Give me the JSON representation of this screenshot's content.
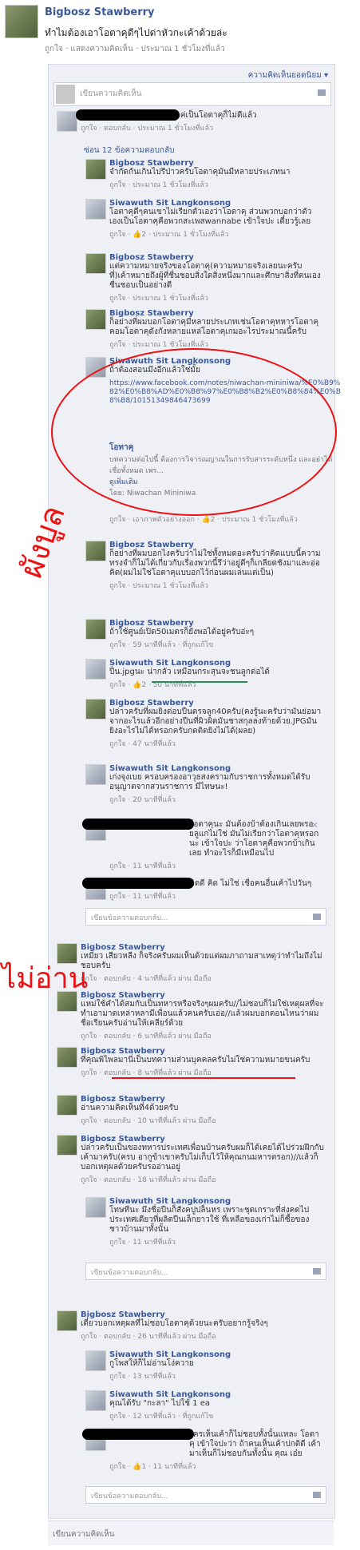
{
  "post": {
    "author": "Bigbosz Stawberry",
    "text": "ทำไมต้องเอาโอตาคุดีๆไปด่าหัวกะเค้าด้วยล่ะ",
    "meta": "ถูกใจ · แสดงความคิดเห็น · ประมาณ 1 ชั่วโมงที่แล้ว"
  },
  "top_link": "ความคิดเห็นยอดนิยม ▾",
  "compose_placeholder": "เขียนความคิดเห็น",
  "reply_placeholder": "เขียนข้อความตอบกลับ...",
  "bottom_placeholder": "เขียนความคิดเห็น",
  "c0": {
    "body": "เเค่เป็นโอตาคุก็ไม่ดีแล้ว",
    "meta": "ถูกใจ · ตอบกลับ · ประมาณ 1 ชั่วโมงที่แล้ว"
  },
  "hide_replies": "ซ่อน 12 ข้อความตอบกลับ",
  "replies": [
    {
      "name": "Bigbosz Stawberry",
      "body": "จำกัดกันเกินไปรึป่าวครับโอตาคุมันมีหลายประเภทนา",
      "meta": "ถูกใจ · ประมาณ 1 ชั่วโมงที่แล้ว"
    },
    {
      "name": "Siwawuth Sit Langkonsong",
      "body": "โอตาคุดีๆคนเขาไม่เรียกตัวเองว่าโอตาคุ ส่วนพวกบอกว่าตัวเองเป็นโอตาคุคือพวกสะเพสwannabe เข้าใจปะ เดี๋ยวรู้เลย",
      "meta": "ถูกใจ · 👍2 · ประมาณ 1 ชั่วโมงที่แล้ว"
    },
    {
      "name": "Bigbosz Stawberry",
      "body": "แต่ความหมายจริงของโอตาคุ(ความหมายจริงเลยนะครับที่)เค้าหมายถึงผู้ที่ชื่นชอบสิ่งใดสิ่งหนึ่งมากและศึกษาสิ่งที่ตนเองชื่นชอบเป็นอย่างดี",
      "meta": "ถูกใจ · ประมาณ 1 ชั่วโมงที่แล้ว"
    },
    {
      "name": "Bigbosz Stawberry",
      "body": "ก็อย่างที่ผมบอกโอตาคุมีหลายประเภทเช่นโอตาคุทหารโอตาคุคอมโอตาคุดังกังหลายแหล่โอตาคุเกมอะไรประมาณนี้ครับ",
      "meta": "ถูกใจ · ประมาณ 1 ชั่วโมงที่แล้ว"
    },
    {
      "name": "Siwawuth Sit Langkonsong",
      "body": "ถ้าต้องสอนมึงอีกแล้วใช่มั้ย",
      "link": "https://www.facebook.com/notes/niwachan-mininiwa/%E0%B9%82%E0%B8%AD%E0%B8%97%E0%B8%B2%E0%B8%84%E0%B8%B8/10151349846473699",
      "preview_title": "โอทาคุ",
      "preview_desc": "บทความต่อไปนี้ ต้องการวิจารณญาณในการรับสารระดับหนึ่ง และอย่าได้เชื่อทั้งหมด เพร...",
      "preview_src": "ดูเพิ่มเติม",
      "preview_by": "โดย: Niwachan Mininiwa",
      "meta": "ถูกใจ · เอาภาพตัวอย่างออก · 👍2 · ประมาณ 1 ชั่วโมงที่แล้ว"
    },
    {
      "name": "Bigbosz Stawberry",
      "body": "ก็อย่างที่ผมบอกไงครับว่าไม่ใช่ทั้งหมดอะครับว่าคิดแบบนี้ความทรงจำก็ไม่ได้เกี่ยวกับเรื่องพวกนี้รึว่าอยู่ดีๆก็เกลียดชังมาและอ่อคิด(ผมไม่ใช่โอตาคุแบบอกไว้ก่อนผมเล่นแต่เป็น)",
      "meta": "ถูกใจ · ประมาณ 1 ชั่วโมงที่แล้ว"
    },
    {
      "name": "Bigbosz Stawberry",
      "body": "ถ้าใช้ศูนย์เปิด50เมตรก็ยังพอได้อยู่ครับอ่ะๆ",
      "meta": "ถูกใจ · 59 นาทีที่แล้ว · ที่ถูกแก้ไข"
    },
    {
      "name": "Siwawuth Sit Langkonsong",
      "body": "ปื่น.jpgนะ น่ากลัว เหมือนกระสุนจะชนลูกต่อได้",
      "meta": "ถูกใจ · 👍2 · 50 นาทีที่แล้ว"
    },
    {
      "name": "Bigbosz Stawberry",
      "body": "ปล่าวครับที่ผมยิงต่อบปืนตรจลูก40ครับ(คงรู้นะครับว่ามันย่อมาจากอะไรแล้วอีกอย่างปืนที่ผิวผิดมันชาสกุลลงท้ายด้วย.JPGมันยิงอะไรไม่ได้หรอกครับกดติดยิงไม่ได้(ผลย)",
      "meta": "ถูกใจ · 47 นาทีที่แล้ว"
    },
    {
      "name": "Siwawuth Sit Langkonsong",
      "body": "เก่งจุงเบย ครอบครองอาวุธสงครามกับราชการทั้งหมดได้รับอนุญาตจากสวนราชการ มีไทษนะ!",
      "meta": "ถูกใจ · 20 นาทีที่แล้ว"
    },
    {
      "name": "",
      "body": "โอตาคุนะ มันต้องบ้าต้องเกินเลยพรอยลูแกไม่ใช่ มันไม่เรียกว่าโอตาคุหรอกนะ เข้าใจปะ ว่าโอตาคุคือพวกบ้าเกินเลย ทำอะไรก็มีเหมือนไป",
      "meta": "ถูกใจ · 11 นาทีที่แล้ว"
    },
    {
      "name": "",
      "body": "คิดดี คิด ไม่ใช่ เชื่อคนอื่นเค้าไปวันๆ",
      "meta": "ถูกใจ · 11 นาทีที่แล้ว"
    }
  ],
  "top_comments": [
    {
      "name": "Bigbosz Stawberry",
      "body": "เหมียว เสียวหลีง ก็จริงครับผมเห็นด้วยแต่ผมภาถามสาเหตุว่าทำไมถึงไม่ชอบครับ",
      "meta": "ถูกใจ · ตอบกลับ · 4 นาทีที่แล้ว ผ่าน มือถือ"
    },
    {
      "name": "Bigbosz Stawberry",
      "body": "แหม่ใช้คำได้สมกับเป็นทหารหรือจริงๆผมครับ//ไม่ชอบก็ไม่ใช่เหตุผลที่จะทำเอามาดเหล่าหลามีเพื่อนแล้วคนครับเอ่อ//แล้วผมบอกตอนไหนว่าผมชื่อเรียนครับอ่านให้เคลียร์ด้วย",
      "meta": "ถูกใจ · ตอบกลับ · 6 นาทีที่แล้ว ผ่าน มือถือ"
    },
    {
      "name": "Bigbosz Stawberry",
      "body": "ที่คุณพิไพลมานี่เป็นบทความส่วนบุคคลครับไม่ใช่ความหมายขนครับ",
      "meta": "ถูกใจ · ตอบกลับ · 8 นาทีที่แล้ว ผ่าน มือถือ"
    },
    {
      "name": "Bigbosz Stawberry",
      "body": "อ่านความคิดเห็นที่4ด้วยครับ",
      "meta": "ถูกใจ · ตอบกลับ · 10 นาทีที่แล้ว ผ่าน มือถือ"
    },
    {
      "name": "Bigbosz Stawberry",
      "body": "ปล่าวครับเป็นของทหารประเทศเพื่อนบ้านครับผมก็ได้เคยได้ไปร่วมฝึกกับเค้ามาครับ(ครบ อากูข้าเขาครับไม่เก็บไว้ให้คุณกนมหารตรอก)//แล้วก็บอกเหตุผลด้วยครับรออ่านอยู่",
      "meta": "ถูกใจ · ตอบกลับ · 18 นาทีที่แล้ว ผ่าน มือถือ"
    },
    {
      "name": "Bigbosz Stawberry",
      "body": "เดี๋ยวบอกเหตุผลที่ไม่ชอบโอตาคุด้วยนะครับอยากรู้จริงๆ",
      "meta": "ถูกใจ · ตอบกลับ · 26 นาทีที่แล้ว ผ่าน มือถือ"
    }
  ],
  "nested_a": {
    "name": "Siwawuth Sit Langkonsong",
    "body": "โทษทีนะ มึงชื่อปืนก็สังคปูปล็นหร เพราะชุดเกราะที่ส่งคดไปประเทศเดียวที่ผลิตปืนเล็กยาวใช้ ที่เหลือของเก่าไม่ก็ซื้อของชาวบ้านมาทั้งนั้น",
    "meta": "ถูกใจ · 11 นาทีที่แล้ว"
  },
  "nested_b": [
    {
      "name": "Siwawuth Sit Langkonsong",
      "body": "กูโพสให้ก็ไม่อ่านโง่ควาย",
      "meta": "ถูกใจ · 13 นาทีที่แล้ว"
    },
    {
      "name": "Siwawuth Sit Langkonsong",
      "body": "คุณได้รับ \"กะลา\" ไปใช้ 1 ea",
      "meta": "ถูกใจ · 12 นาทีที่แล้ว · ที่ถูกแก้ไข"
    },
    {
      "name": "",
      "body": "ใครเห็นเค้าก็ไม่ชอบทั้งนั้นแหละ โอตาคุ เข้าใจปะว่า ถ้าคนเห็นเค้าปกติดี เค้ามาเห็นก็ไม่ชอบกันทั้งนั้น คุณ เอ๋ย",
      "meta": "ถูกใจ · 👍1 · 11 นาทีที่แล้ว"
    }
  ],
  "annotations": {
    "left": "ผังบูล",
    "right": "ไม่อ่าน"
  }
}
